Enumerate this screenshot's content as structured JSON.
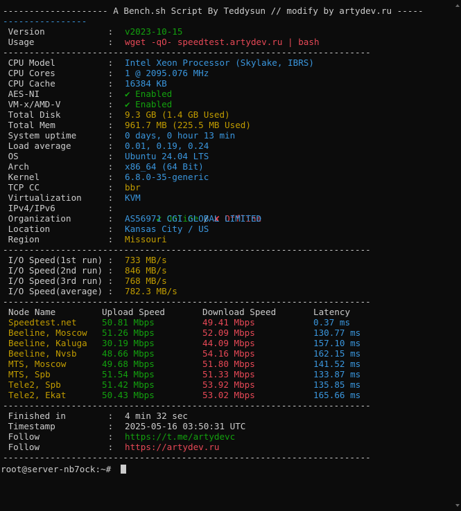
{
  "banner": {
    "line1": "-------------------- A Bench.sh Script By Teddysun // modify by artydev.ru -----",
    "line2": "----------------"
  },
  "separator": "----------------------------------------------------------------------",
  "header": [
    {
      "label": " Version            : ",
      "value": "v2023-10-15",
      "color": "g"
    },
    {
      "label": " Usage              : ",
      "value": "wget -qO- speedtest.artydev.ru | bash",
      "color": "r"
    }
  ],
  "system": [
    {
      "label": " CPU Model          : ",
      "value": "Intel Xeon Processor (Skylake, IBRS)",
      "color": "c"
    },
    {
      "label": " CPU Cores          : ",
      "value": "1 @ 2095.076 MHz",
      "color": "c"
    },
    {
      "label": " CPU Cache          : ",
      "value": "16384 KB",
      "color": "c"
    },
    {
      "label": " AES-NI             : ",
      "value": "✔ Enabled",
      "color": "g"
    },
    {
      "label": " VM-x/AMD-V         : ",
      "value": "✔ Enabled",
      "color": "g"
    },
    {
      "label": " Total Disk         : ",
      "value": "9.3 GB (1.4 GB Used)",
      "color": "y"
    },
    {
      "label": " Total Mem          : ",
      "value": "961.7 MB (225.5 MB Used)",
      "color": "y"
    },
    {
      "label": " System uptime      : ",
      "value": "0 days, 0 hour 13 min",
      "color": "c"
    },
    {
      "label": " Load average       : ",
      "value": "0.01, 0.19, 0.24",
      "color": "c"
    },
    {
      "label": " OS                 : ",
      "value": "Ubuntu 24.04 LTS",
      "color": "c"
    },
    {
      "label": " Arch               : ",
      "value": "x86_64 (64 Bit)",
      "color": "c"
    },
    {
      "label": " Kernel             : ",
      "value": "6.8.0-35-generic",
      "color": "c"
    },
    {
      "label": " TCP CC             : ",
      "value": "bbr",
      "color": "y"
    },
    {
      "label": " Virtualization     : ",
      "value": "KVM",
      "color": "c"
    }
  ],
  "ipv": {
    "label": " IPv4/IPv6          : ",
    "online": "✔ Online",
    "slash": " / ",
    "offline": "✘ Offline"
  },
  "location": [
    {
      "label": " Organization       : ",
      "value": "AS56971 CGI GLOBAL LIMITED",
      "color": "c"
    },
    {
      "label": " Location           : ",
      "value": "Kansas City / US",
      "color": "c"
    },
    {
      "label": " Region             : ",
      "value": "Missouri",
      "color": "y"
    }
  ],
  "io": [
    {
      "label": " I/O Speed(1st run) : ",
      "value": "733 MB/s"
    },
    {
      "label": " I/O Speed(2nd run) : ",
      "value": "846 MB/s"
    },
    {
      "label": " I/O Speed(3rd run) : ",
      "value": "768 MB/s"
    },
    {
      "label": " I/O Speed(average) : ",
      "value": "782.3 MB/s"
    }
  ],
  "speed_headers": {
    "node": "Node Name",
    "upload": "Upload Speed",
    "download": "Download Speed",
    "latency": "Latency"
  },
  "speed_rows": [
    {
      "node": "Speedtest.net",
      "upload": "50.81 Mbps",
      "download": "49.41 Mbps",
      "latency": "0.37 ms"
    },
    {
      "node": "Beeline, Moscow",
      "upload": "51.26 Mbps",
      "download": "52.09 Mbps",
      "latency": "130.77 ms"
    },
    {
      "node": "Beeline, Kaluga",
      "upload": "30.19 Mbps",
      "download": "44.09 Mbps",
      "latency": "157.10 ms"
    },
    {
      "node": "Beeline, Nvsb",
      "upload": "48.66 Mbps",
      "download": "54.16 Mbps",
      "latency": "162.15 ms"
    },
    {
      "node": "MTS, Moscow",
      "upload": "49.68 Mbps",
      "download": "51.80 Mbps",
      "latency": "141.52 ms"
    },
    {
      "node": "MTS, Spb",
      "upload": "51.54 Mbps",
      "download": "51.33 Mbps",
      "latency": "133.87 ms"
    },
    {
      "node": "Tele2, Spb",
      "upload": "51.42 Mbps",
      "download": "53.92 Mbps",
      "latency": "135.85 ms"
    },
    {
      "node": "Tele2, Ekat",
      "upload": "50.43 Mbps",
      "download": "53.02 Mbps",
      "latency": "165.66 ms"
    }
  ],
  "footer": [
    {
      "label": " Finished in        : ",
      "value": "4 min 32 sec",
      "color": "w"
    },
    {
      "label": " Timestamp          : ",
      "value": "2025-05-16 03:50:31 UTC",
      "color": "w"
    },
    {
      "label": " Follow             : ",
      "value": "https://t.me/artydevc",
      "color": "g"
    },
    {
      "label": " Follow             : ",
      "value": "https://artydev.ru",
      "color": "r"
    }
  ],
  "prompt": "root@server-nb7ock:~# "
}
